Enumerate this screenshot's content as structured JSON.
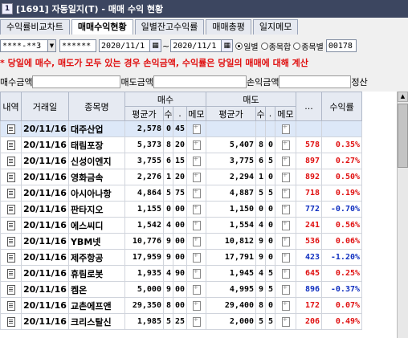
{
  "window": {
    "title": "[1691] 자동일지(T) - 매매 수익 현황",
    "icon": "window-icon"
  },
  "tabs": [
    {
      "label": "수익률비교차트"
    },
    {
      "label": "매매수익현황",
      "active": true
    },
    {
      "label": "일별잔고수익률"
    },
    {
      "label": "매매총평"
    },
    {
      "label": "일지메모"
    }
  ],
  "toolbar": {
    "account": "****-**3",
    "password": "******",
    "date_from": "2020/11/1",
    "date_sep": "~",
    "date_to": "2020/11/1",
    "radios": [
      {
        "label": "일별",
        "checked": true
      },
      {
        "label": "종목합",
        "checked": false
      },
      {
        "label": "종목별",
        "checked": false
      }
    ],
    "code": "00178"
  },
  "warning": "* 당일에 매수, 매도가 모두 있는 경우 손익금액, 수익률은 당일의 매매에 대해 계산",
  "amounts": {
    "buy_label": "매수금액",
    "sell_label": "매도금액",
    "pnl_label": "손익금액",
    "settle_label": "정산"
  },
  "table": {
    "group_headers": {
      "buy": "매수",
      "sell": "매도"
    },
    "headers": {
      "detail": "내역",
      "date": "거래일",
      "name": "종목명",
      "buy_avg": "평균가",
      "buy_qty": "수",
      "buy_sep": ".",
      "buy_memo": "메모",
      "sell_avg": "평균가",
      "sell_qty": "수",
      "sell_sep": ".",
      "sell_memo": "메모",
      "extra": "...",
      "rate": "수익률"
    },
    "rows": [
      {
        "date": "20/11/16",
        "name": "대주산업",
        "buy_avg": "2,578",
        "buy_qty": "0",
        "buy_x": "45",
        "sell_avg": "",
        "sell_qty": "",
        "sell_x": "",
        "pnl": "",
        "rate": "",
        "color": ""
      },
      {
        "date": "20/11/16",
        "name": "태림포장",
        "buy_avg": "5,373",
        "buy_qty": "8",
        "buy_x": "20",
        "sell_avg": "5,407",
        "sell_qty": "8",
        "sell_x": "0",
        "pnl": "578",
        "rate": "0.35%",
        "color": "red"
      },
      {
        "date": "20/11/16",
        "name": "신성이엔지",
        "buy_avg": "3,755",
        "buy_qty": "6",
        "buy_x": "15",
        "sell_avg": "3,775",
        "sell_qty": "6",
        "sell_x": "5",
        "pnl": "897",
        "rate": "0.27%",
        "color": "red"
      },
      {
        "date": "20/11/16",
        "name": "영화금속",
        "buy_avg": "2,276",
        "buy_qty": "1",
        "buy_x": "20",
        "sell_avg": "2,294",
        "sell_qty": "1",
        "sell_x": "0",
        "pnl": "892",
        "rate": "0.50%",
        "color": "red"
      },
      {
        "date": "20/11/16",
        "name": "아시아나항",
        "buy_avg": "4,864",
        "buy_qty": "5",
        "buy_x": "75",
        "sell_avg": "4,887",
        "sell_qty": "5",
        "sell_x": "5",
        "pnl": "718",
        "rate": "0.19%",
        "color": "red"
      },
      {
        "date": "20/11/16",
        "name": "판타지오",
        "buy_avg": "1,155",
        "buy_qty": "0",
        "buy_x": "00",
        "sell_avg": "1,150",
        "sell_qty": "0",
        "sell_x": "0",
        "pnl": "772",
        "rate": "-0.70%",
        "color": "blue"
      },
      {
        "date": "20/11/16",
        "name": "에스씨디",
        "buy_avg": "1,542",
        "buy_qty": "4",
        "buy_x": "00",
        "sell_avg": "1,554",
        "sell_qty": "4",
        "sell_x": "0",
        "pnl": "241",
        "rate": "0.56%",
        "color": "red"
      },
      {
        "date": "20/11/16",
        "name": "YBM넷",
        "buy_avg": "10,776",
        "buy_qty": "9",
        "buy_x": "00",
        "sell_avg": "10,812",
        "sell_qty": "9",
        "sell_x": "0",
        "pnl": "536",
        "rate": "0.06%",
        "color": "red"
      },
      {
        "date": "20/11/16",
        "name": "제주항공",
        "buy_avg": "17,959",
        "buy_qty": "9",
        "buy_x": "00",
        "sell_avg": "17,791",
        "sell_qty": "9",
        "sell_x": "0",
        "pnl": "423",
        "rate": "-1.20%",
        "color": "blue"
      },
      {
        "date": "20/11/16",
        "name": "휴림로봇",
        "buy_avg": "1,935",
        "buy_qty": "4",
        "buy_x": "90",
        "sell_avg": "1,945",
        "sell_qty": "4",
        "sell_x": "5",
        "pnl": "645",
        "rate": "0.25%",
        "color": "red"
      },
      {
        "date": "20/11/16",
        "name": "켐온",
        "buy_avg": "5,000",
        "buy_qty": "9",
        "buy_x": "00",
        "sell_avg": "4,995",
        "sell_qty": "9",
        "sell_x": "5",
        "pnl": "896",
        "rate": "-0.37%",
        "color": "blue"
      },
      {
        "date": "20/11/16",
        "name": "교촌에프앤",
        "buy_avg": "29,350",
        "buy_qty": "8",
        "buy_x": "00",
        "sell_avg": "29,400",
        "sell_qty": "8",
        "sell_x": "0",
        "pnl": "172",
        "rate": "0.07%",
        "color": "red"
      },
      {
        "date": "20/11/16",
        "name": "크리스탈신",
        "buy_avg": "1,985",
        "buy_qty": "5",
        "buy_x": "25",
        "sell_avg": "2,000",
        "sell_qty": "5",
        "sell_x": "5",
        "pnl": "206",
        "rate": "0.49%",
        "color": "red"
      }
    ]
  }
}
